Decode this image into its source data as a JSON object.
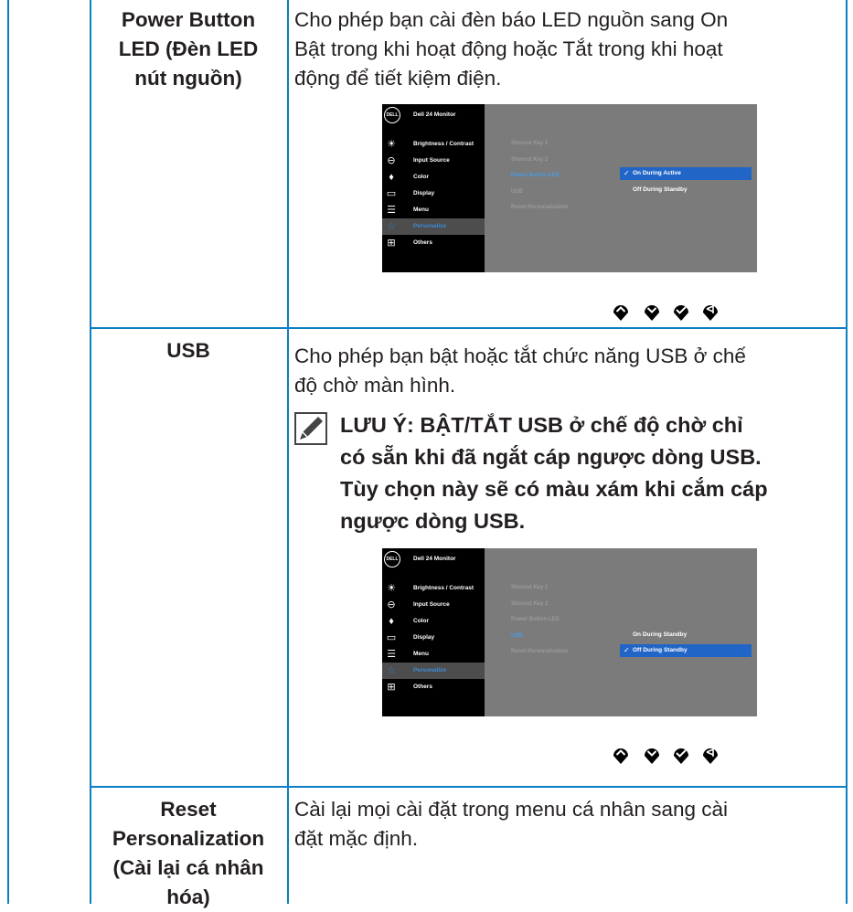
{
  "rows": [
    {
      "label_lines": [
        "Power Button",
        "LED (Đèn LED",
        "nút nguồn)"
      ],
      "desc_lines": [
        "Cho phép bạn cài đèn báo LED nguồn sang On",
        "Bật trong khi hoạt động hoặc Tắt trong khi hoạt",
        "động để tiết kiệm điện."
      ]
    },
    {
      "label_lines": [
        "USB"
      ],
      "desc_lines": [
        "Cho phép bạn bật hoặc tắt chức năng USB ở chế",
        "độ chờ màn hình."
      ],
      "note_lines": [
        "LƯU Ý: BẬT/TẮT USB ở chế độ chờ chỉ",
        "có sẵn khi đã ngắt cáp ngược dòng USB.",
        "Tùy chọn này sẽ có màu xám khi cắm cáp",
        "ngược dòng USB."
      ]
    },
    {
      "label_lines": [
        "Reset",
        "Personalization",
        "(Cài lại cá nhân",
        "hóa)"
      ],
      "desc_lines": [
        "Cài lại mọi cài đặt trong menu cá nhân sang cài",
        "đặt mặc định."
      ]
    }
  ],
  "osd": {
    "logo": "DELL",
    "title": "Dell 24 Monitor",
    "menu": [
      {
        "label": "Brightness / Contrast",
        "icon": "brightness-icon"
      },
      {
        "label": "Input Source",
        "icon": "input-source-icon"
      },
      {
        "label": "Color",
        "icon": "color-icon"
      },
      {
        "label": "Display",
        "icon": "display-icon"
      },
      {
        "label": "Menu",
        "icon": "menu-icon"
      },
      {
        "label": "Personalize",
        "icon": "star-icon"
      },
      {
        "label": "Others",
        "icon": "others-icon"
      }
    ],
    "submenu": [
      "Shorcut Key 1",
      "Shorcut Key 2",
      "Power Button LED",
      "USB",
      "Reset Personalization"
    ],
    "screen1": {
      "highlight": "Power Button LED",
      "options": [
        "On During Active",
        "Off During Standby"
      ],
      "selected_option": "On During Active"
    },
    "screen2": {
      "highlight": "USB",
      "options": [
        "On During Standby",
        "Off During Standby"
      ],
      "selected_option": "Off During Standby"
    },
    "nav_icons": [
      "up-arrow-icon",
      "down-arrow-icon",
      "check-icon",
      "back-icon"
    ]
  },
  "colors": {
    "rule": "#0a7fc4",
    "osd_bg": "#7b7b7b",
    "osd_highlight": "#2165c7"
  }
}
